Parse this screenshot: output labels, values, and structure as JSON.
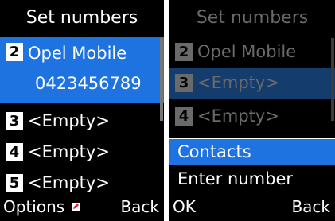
{
  "left_screen": {
    "title": "Set numbers",
    "items": [
      {
        "number": "2",
        "name": "Opel Mobile",
        "phone": "0423456789",
        "selected": true
      },
      {
        "number": "3",
        "name": "<Empty>",
        "selected": false
      },
      {
        "number": "4",
        "name": "<Empty>",
        "selected": false
      },
      {
        "number": "5",
        "name": "<Empty>",
        "selected": false
      }
    ],
    "softkeys": {
      "left": "Options",
      "right": "Back"
    }
  },
  "right_screen": {
    "title": "Set numbers",
    "items": [
      {
        "number": "2",
        "name": "Opel Mobile",
        "selected": false
      },
      {
        "number": "3",
        "name": "<Empty>",
        "selected": true
      },
      {
        "number": "4",
        "name": "<Empty>",
        "selected": false
      }
    ],
    "popup_menu": {
      "options": [
        {
          "label": "Contacts",
          "selected": true
        },
        {
          "label": "Enter number",
          "selected": false
        }
      ]
    },
    "softkeys": {
      "left": "OK",
      "right": "Back"
    }
  },
  "colors": {
    "highlight": "#1e73e0",
    "background": "#000000",
    "text": "#ffffff",
    "dimmed_text": "#6a6a6a",
    "edit_icon": "#e0244a"
  },
  "icons": {
    "options_indicator": "edit-pencil-icon"
  }
}
